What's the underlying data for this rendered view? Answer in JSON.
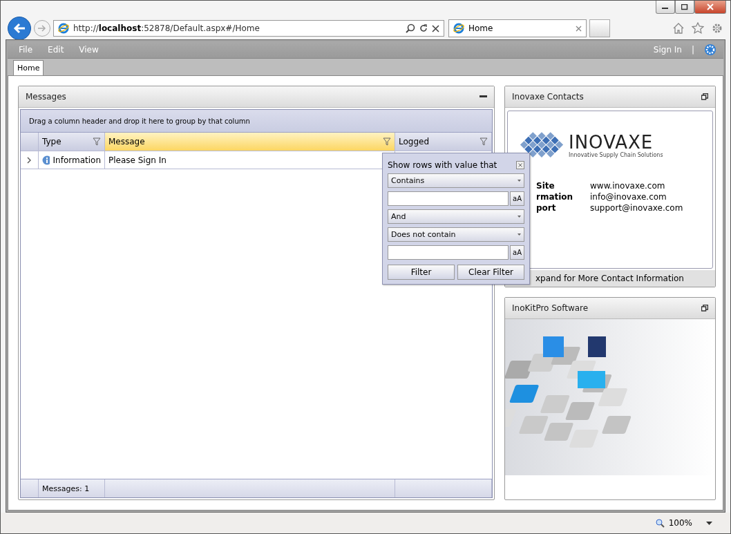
{
  "browser": {
    "address": {
      "prefix": "http://",
      "host": "localhost",
      "rest": ":52878/Default.aspx#/Home"
    },
    "tabs": [
      {
        "label": "Home",
        "selected": true
      }
    ],
    "zoom": "100%"
  },
  "menu": {
    "items": [
      "File",
      "Edit",
      "View"
    ],
    "right": [
      "Sign In",
      "|"
    ]
  },
  "page_tabs": [
    {
      "label": "Home",
      "selected": true
    }
  ],
  "messages_panel": {
    "title": "Messages",
    "group_hint": "Drag a column header and drop it here to group by that column",
    "columns": [
      {
        "label": "Type",
        "highlighted": false
      },
      {
        "label": "Message",
        "highlighted": true
      },
      {
        "label": "Logged",
        "highlighted": false
      }
    ],
    "rows": [
      {
        "type": "Information",
        "message": "Please Sign In",
        "logged": ""
      }
    ],
    "footer": "Messages: 1"
  },
  "filter_popup": {
    "title": "Show rows with value that",
    "first_operator": "Contains",
    "case_button_1": "aA",
    "logic": "And",
    "second_operator": "Does not contain",
    "case_button_2": "aA",
    "buttons": [
      "Filter",
      "Clear Filter"
    ]
  },
  "contacts_panel": {
    "title": "Inovaxe Contacts",
    "logo": {
      "name": "INOVAXE",
      "tagline": "Innovative Supply Chain Solutions"
    },
    "contacts": [
      {
        "label": "Site",
        "value": "www.inovaxe.com"
      },
      {
        "label": "rmation",
        "value": "info@inovaxe.com"
      },
      {
        "label": "port",
        "value": "support@inovaxe.com"
      }
    ],
    "footer": "xpand for More Contact Information"
  },
  "software_panel": {
    "title": "InoKitPro Software"
  }
}
